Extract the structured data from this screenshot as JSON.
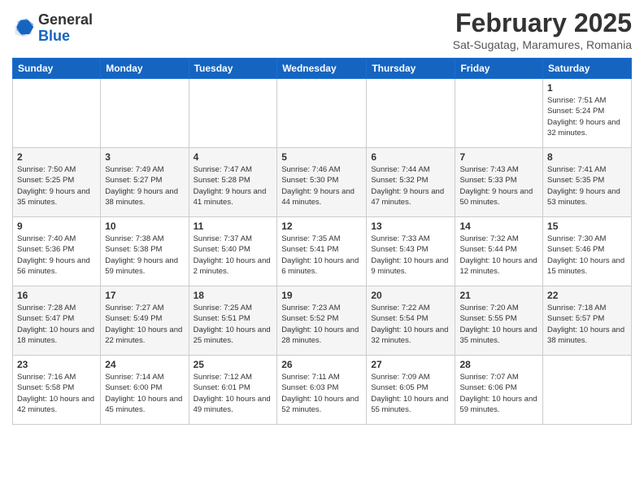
{
  "header": {
    "logo_general": "General",
    "logo_blue": "Blue",
    "month_title": "February 2025",
    "location": "Sat-Sugatag, Maramures, Romania"
  },
  "weekdays": [
    "Sunday",
    "Monday",
    "Tuesday",
    "Wednesday",
    "Thursday",
    "Friday",
    "Saturday"
  ],
  "weeks": [
    [
      {
        "day": "",
        "info": ""
      },
      {
        "day": "",
        "info": ""
      },
      {
        "day": "",
        "info": ""
      },
      {
        "day": "",
        "info": ""
      },
      {
        "day": "",
        "info": ""
      },
      {
        "day": "",
        "info": ""
      },
      {
        "day": "1",
        "info": "Sunrise: 7:51 AM\nSunset: 5:24 PM\nDaylight: 9 hours and 32 minutes."
      }
    ],
    [
      {
        "day": "2",
        "info": "Sunrise: 7:50 AM\nSunset: 5:25 PM\nDaylight: 9 hours and 35 minutes."
      },
      {
        "day": "3",
        "info": "Sunrise: 7:49 AM\nSunset: 5:27 PM\nDaylight: 9 hours and 38 minutes."
      },
      {
        "day": "4",
        "info": "Sunrise: 7:47 AM\nSunset: 5:28 PM\nDaylight: 9 hours and 41 minutes."
      },
      {
        "day": "5",
        "info": "Sunrise: 7:46 AM\nSunset: 5:30 PM\nDaylight: 9 hours and 44 minutes."
      },
      {
        "day": "6",
        "info": "Sunrise: 7:44 AM\nSunset: 5:32 PM\nDaylight: 9 hours and 47 minutes."
      },
      {
        "day": "7",
        "info": "Sunrise: 7:43 AM\nSunset: 5:33 PM\nDaylight: 9 hours and 50 minutes."
      },
      {
        "day": "8",
        "info": "Sunrise: 7:41 AM\nSunset: 5:35 PM\nDaylight: 9 hours and 53 minutes."
      }
    ],
    [
      {
        "day": "9",
        "info": "Sunrise: 7:40 AM\nSunset: 5:36 PM\nDaylight: 9 hours and 56 minutes."
      },
      {
        "day": "10",
        "info": "Sunrise: 7:38 AM\nSunset: 5:38 PM\nDaylight: 9 hours and 59 minutes."
      },
      {
        "day": "11",
        "info": "Sunrise: 7:37 AM\nSunset: 5:40 PM\nDaylight: 10 hours and 2 minutes."
      },
      {
        "day": "12",
        "info": "Sunrise: 7:35 AM\nSunset: 5:41 PM\nDaylight: 10 hours and 6 minutes."
      },
      {
        "day": "13",
        "info": "Sunrise: 7:33 AM\nSunset: 5:43 PM\nDaylight: 10 hours and 9 minutes."
      },
      {
        "day": "14",
        "info": "Sunrise: 7:32 AM\nSunset: 5:44 PM\nDaylight: 10 hours and 12 minutes."
      },
      {
        "day": "15",
        "info": "Sunrise: 7:30 AM\nSunset: 5:46 PM\nDaylight: 10 hours and 15 minutes."
      }
    ],
    [
      {
        "day": "16",
        "info": "Sunrise: 7:28 AM\nSunset: 5:47 PM\nDaylight: 10 hours and 18 minutes."
      },
      {
        "day": "17",
        "info": "Sunrise: 7:27 AM\nSunset: 5:49 PM\nDaylight: 10 hours and 22 minutes."
      },
      {
        "day": "18",
        "info": "Sunrise: 7:25 AM\nSunset: 5:51 PM\nDaylight: 10 hours and 25 minutes."
      },
      {
        "day": "19",
        "info": "Sunrise: 7:23 AM\nSunset: 5:52 PM\nDaylight: 10 hours and 28 minutes."
      },
      {
        "day": "20",
        "info": "Sunrise: 7:22 AM\nSunset: 5:54 PM\nDaylight: 10 hours and 32 minutes."
      },
      {
        "day": "21",
        "info": "Sunrise: 7:20 AM\nSunset: 5:55 PM\nDaylight: 10 hours and 35 minutes."
      },
      {
        "day": "22",
        "info": "Sunrise: 7:18 AM\nSunset: 5:57 PM\nDaylight: 10 hours and 38 minutes."
      }
    ],
    [
      {
        "day": "23",
        "info": "Sunrise: 7:16 AM\nSunset: 5:58 PM\nDaylight: 10 hours and 42 minutes."
      },
      {
        "day": "24",
        "info": "Sunrise: 7:14 AM\nSunset: 6:00 PM\nDaylight: 10 hours and 45 minutes."
      },
      {
        "day": "25",
        "info": "Sunrise: 7:12 AM\nSunset: 6:01 PM\nDaylight: 10 hours and 49 minutes."
      },
      {
        "day": "26",
        "info": "Sunrise: 7:11 AM\nSunset: 6:03 PM\nDaylight: 10 hours and 52 minutes."
      },
      {
        "day": "27",
        "info": "Sunrise: 7:09 AM\nSunset: 6:05 PM\nDaylight: 10 hours and 55 minutes."
      },
      {
        "day": "28",
        "info": "Sunrise: 7:07 AM\nSunset: 6:06 PM\nDaylight: 10 hours and 59 minutes."
      },
      {
        "day": "",
        "info": ""
      }
    ]
  ]
}
